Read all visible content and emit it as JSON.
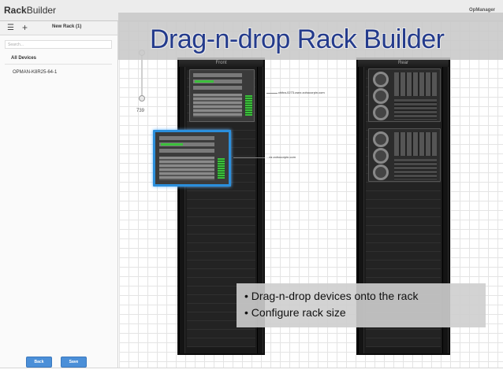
{
  "app": {
    "brand_prefix": "Rack",
    "brand_suffix": "Builder",
    "product": "OpManager"
  },
  "sidebar": {
    "menu_icon": "☰",
    "add_icon": "+",
    "rack_name": "New Rack (1)",
    "search_placeholder": "Search...",
    "section_label": "All Devices",
    "devices": [
      "OPMAN-K8R25-64-1"
    ]
  },
  "buttons": {
    "back": "Back",
    "save": "Save"
  },
  "zoom": {
    "label": "739"
  },
  "racks": {
    "front_label": "Front",
    "rear_label": "Rear"
  },
  "device_labels": [
    "chitra-0273.csez.zohocorpin.com",
    "...ez.zohocorpin.com"
  ],
  "slide": {
    "title": "Drag-n-drop Rack Builder",
    "bullets": [
      "Drag-n-drop devices onto the rack",
      "Configure rack size"
    ]
  },
  "colors": {
    "title_color": "#243b8c",
    "button_blue": "#4b8fd8",
    "drag_highlight": "#2b8fdc",
    "led_green": "#3bbf3b"
  }
}
